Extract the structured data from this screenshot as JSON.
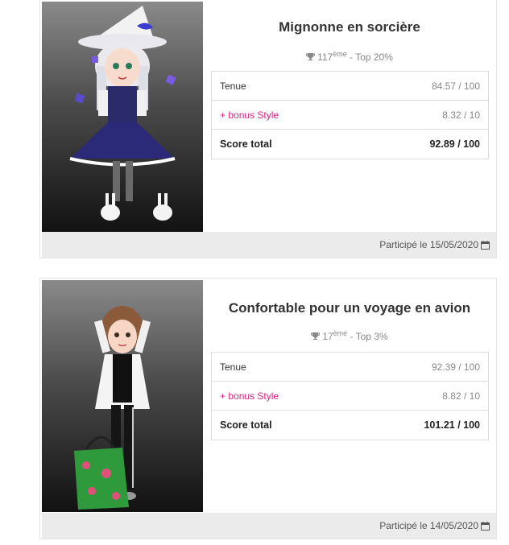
{
  "cards": [
    {
      "title": "Mignonne en sorcière",
      "rank_number": "117",
      "rank_suffix": "ème",
      "rank_rest": " - Top 20%",
      "rows": [
        {
          "label": "Tenue",
          "value": "84.57 / 100"
        },
        {
          "label": "+ bonus Style",
          "value": "8.32 / 10"
        },
        {
          "label": "Score total",
          "value": "92.89 / 100"
        }
      ],
      "participated": "Participé le 15/05/2020"
    },
    {
      "title": "Confortable pour un voyage en avion",
      "rank_number": "17",
      "rank_suffix": "ème",
      "rank_rest": " - Top 3%",
      "rows": [
        {
          "label": "Tenue",
          "value": "92.39 / 100"
        },
        {
          "label": "+ bonus Style",
          "value": "8.82 / 10"
        },
        {
          "label": "Score total",
          "value": "101.21 / 100"
        }
      ],
      "participated": "Participé le 14/05/2020"
    }
  ],
  "icons": {
    "rank": "trophy-icon",
    "date": "calendar-icon"
  },
  "colors": {
    "bonus": "#d6247d",
    "footer_bg": "#ebebeb"
  }
}
